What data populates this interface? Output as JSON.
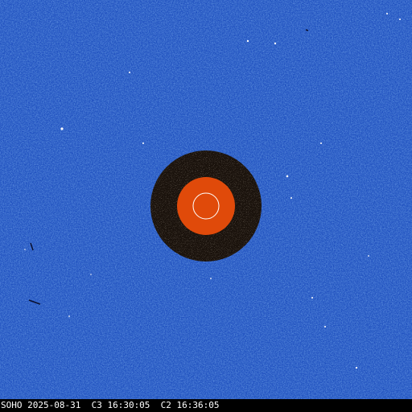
{
  "image": {
    "caption": "SOHO 2025-08-31  C3 16:30:05  C2 16:36:05",
    "colors": {
      "background": "#1f4fbf",
      "background_dark": "#1a44a8",
      "background_light": "#2f64d8",
      "occulting_disk": "#e04a0a",
      "inner_field": "#1a120c",
      "sun_outline": "#ffffff",
      "caption_text": "#ffffff",
      "caption_background": "#000000"
    }
  }
}
